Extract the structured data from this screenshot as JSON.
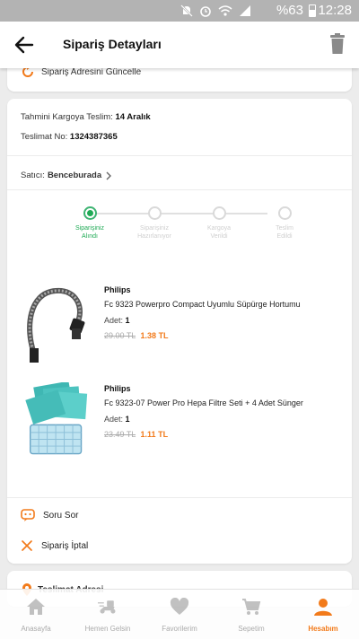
{
  "status_bar": {
    "battery": "%63",
    "time": "12:28"
  },
  "app_bar": {
    "title": "Sipariş Detayları"
  },
  "address_update": {
    "label": "Sipariş Adresini Güncelle"
  },
  "shipment": {
    "estimated_label": "Tahmini Kargoya Teslim:",
    "estimated_value": "14 Aralık",
    "tracking_label": "Teslimat No:",
    "tracking_value": "1324387365"
  },
  "seller": {
    "label": "Satıcı:",
    "name": "Benceburada"
  },
  "steps": [
    {
      "line1": "Siparişiniz",
      "line2": "Alındı",
      "active": true
    },
    {
      "line1": "Siparişiniz",
      "line2": "Hazırlanıyor",
      "active": false
    },
    {
      "line1": "Kargoya",
      "line2": "Verildi",
      "active": false
    },
    {
      "line1": "Teslim",
      "line2": "Edildi",
      "active": false
    }
  ],
  "products": [
    {
      "brand": "Philips",
      "name": "Fc 9323 Powerpro Compact Uyumlu Süpürge Hortumu",
      "qty_label": "Adet:",
      "qty": "1",
      "old_price": "29.00 TL",
      "new_price": "1.38 TL"
    },
    {
      "brand": "Philips",
      "name": "Fc 9323-07 Power Pro Hepa Filtre Seti + 4 Adet Sünger",
      "qty_label": "Adet:",
      "qty": "1",
      "old_price": "23.49 TL",
      "new_price": "1.11 TL"
    }
  ],
  "actions": {
    "ask": "Soru Sor",
    "cancel": "Sipariş İptal"
  },
  "delivery_address": {
    "title": "Teslimat Adresi"
  },
  "nav": [
    {
      "label": "Anasayfa",
      "icon": "home-icon"
    },
    {
      "label": "Hemen Gelsin",
      "icon": "delivery-scooter-icon"
    },
    {
      "label": "Favorilerim",
      "icon": "heart-icon"
    },
    {
      "label": "Sepetim",
      "icon": "cart-icon"
    },
    {
      "label": "Hesabım",
      "icon": "user-icon",
      "active": true
    }
  ],
  "colors": {
    "accent": "#f27a1a",
    "success": "#1faa55"
  }
}
